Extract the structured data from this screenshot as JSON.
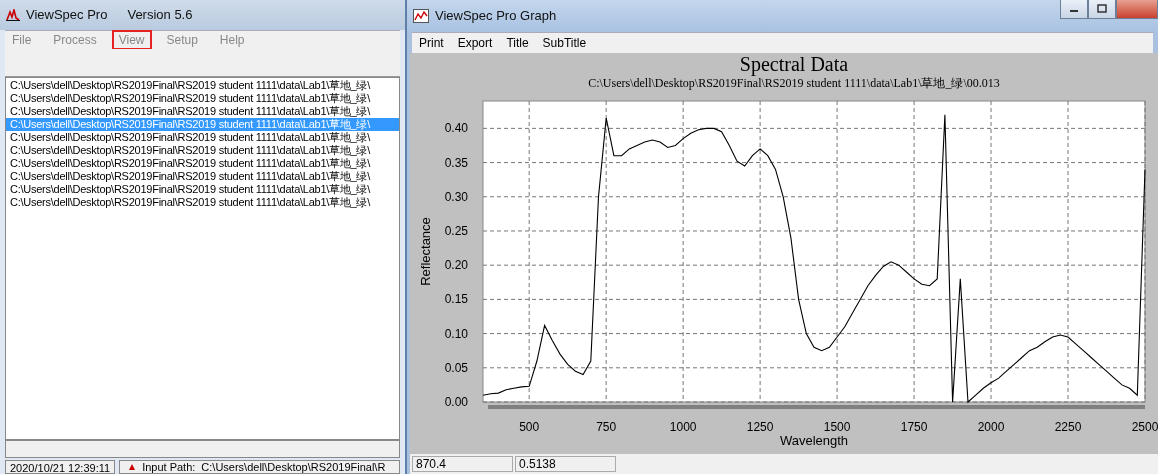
{
  "main_window": {
    "title": "ViewSpec Pro",
    "version": "Version 5.6",
    "menu": [
      {
        "label": "File",
        "highlighted": false
      },
      {
        "label": "Process",
        "highlighted": false
      },
      {
        "label": "View",
        "highlighted": true
      },
      {
        "label": "Setup",
        "highlighted": false
      },
      {
        "label": "Help",
        "highlighted": false
      }
    ],
    "files": [
      {
        "path": "C:\\Users\\dell\\Desktop\\RS2019Final\\RS2019 student 1111\\data\\Lab1\\草地_绿\\",
        "selected": false
      },
      {
        "path": "C:\\Users\\dell\\Desktop\\RS2019Final\\RS2019 student 1111\\data\\Lab1\\草地_绿\\",
        "selected": false
      },
      {
        "path": "C:\\Users\\dell\\Desktop\\RS2019Final\\RS2019 student 1111\\data\\Lab1\\草地_绿\\",
        "selected": false
      },
      {
        "path": "C:\\Users\\dell\\Desktop\\RS2019Final\\RS2019 student 1111\\data\\Lab1\\草地_绿\\",
        "selected": true
      },
      {
        "path": "C:\\Users\\dell\\Desktop\\RS2019Final\\RS2019 student 1111\\data\\Lab1\\草地_绿\\",
        "selected": false
      },
      {
        "path": "C:\\Users\\dell\\Desktop\\RS2019Final\\RS2019 student 1111\\data\\Lab1\\草地_绿\\",
        "selected": false
      },
      {
        "path": "C:\\Users\\dell\\Desktop\\RS2019Final\\RS2019 student 1111\\data\\Lab1\\草地_绿\\",
        "selected": false
      },
      {
        "path": "C:\\Users\\dell\\Desktop\\RS2019Final\\RS2019 student 1111\\data\\Lab1\\草地_绿\\",
        "selected": false
      },
      {
        "path": "C:\\Users\\dell\\Desktop\\RS2019Final\\RS2019 student 1111\\data\\Lab1\\草地_绿\\",
        "selected": false
      },
      {
        "path": "C:\\Users\\dell\\Desktop\\RS2019Final\\RS2019 student 1111\\data\\Lab1\\草地_绿\\",
        "selected": false
      }
    ],
    "status_bar": {
      "time": "2020/10/21 12:39:11",
      "input_label": "Input Path:",
      "input_path": "C:\\Users\\dell\\Desktop\\RS2019Final\\R"
    }
  },
  "graph_window": {
    "title": "ViewSpec Pro Graph",
    "menu": [
      "Print",
      "Export",
      "Title",
      "SubTitle"
    ],
    "chart_data": {
      "type": "line",
      "title": "Spectral Data",
      "subtitle": "C:\\Users\\dell\\Desktop\\RS2019Final\\RS2019 student 1111\\data\\Lab1\\草地_绿\\00.013",
      "xlabel": "Wavelength",
      "ylabel": "Reflectance",
      "x": [
        350,
        375,
        400,
        425,
        450,
        475,
        500,
        525,
        550,
        575,
        600,
        625,
        650,
        675,
        700,
        725,
        750,
        775,
        800,
        825,
        850,
        875,
        900,
        925,
        950,
        975,
        1000,
        1025,
        1050,
        1075,
        1100,
        1125,
        1150,
        1175,
        1200,
        1225,
        1250,
        1275,
        1300,
        1325,
        1350,
        1375,
        1400,
        1425,
        1450,
        1475,
        1500,
        1525,
        1550,
        1575,
        1600,
        1625,
        1650,
        1675,
        1700,
        1725,
        1750,
        1775,
        1800,
        1825,
        1850,
        1875,
        1900,
        1925,
        1950,
        1975,
        2000,
        2025,
        2050,
        2075,
        2100,
        2125,
        2150,
        2175,
        2200,
        2225,
        2250,
        2275,
        2300,
        2325,
        2350,
        2375,
        2400,
        2425,
        2450,
        2475,
        2500
      ],
      "grid": true,
      "series": [
        {
          "color": "#000000",
          "values": [
            0.01,
            0.012,
            0.013,
            0.018,
            0.02,
            0.022,
            0.023,
            0.06,
            0.112,
            0.09,
            0.07,
            0.055,
            0.045,
            0.04,
            0.06,
            0.3,
            0.415,
            0.36,
            0.36,
            0.37,
            0.375,
            0.38,
            0.383,
            0.38,
            0.372,
            0.375,
            0.385,
            0.393,
            0.398,
            0.4,
            0.4,
            0.395,
            0.375,
            0.352,
            0.345,
            0.36,
            0.37,
            0.36,
            0.34,
            0.3,
            0.24,
            0.15,
            0.1,
            0.08,
            0.075,
            0.08,
            0.095,
            0.11,
            0.13,
            0.15,
            0.17,
            0.185,
            0.198,
            0.205,
            0.2,
            0.19,
            0.18,
            0.172,
            0.17,
            0.18,
            0.42,
            0.0,
            0.18,
            0.0,
            0.01,
            0.02,
            0.028,
            0.035,
            0.045,
            0.055,
            0.065,
            0.075,
            0.08,
            0.088,
            0.095,
            0.098,
            0.095,
            0.085,
            0.075,
            0.065,
            0.055,
            0.045,
            0.035,
            0.025,
            0.02,
            0.01,
            0.34
          ]
        }
      ],
      "xlim": [
        350,
        2500
      ],
      "ylim": [
        0,
        0.44
      ],
      "xticks": [
        500,
        750,
        1000,
        1250,
        1500,
        1750,
        2000,
        2250,
        2500
      ],
      "yticks": [
        {
          "value": 0,
          "label": "0.00"
        },
        {
          "value": 0.05,
          "label": "0.05"
        },
        {
          "value": 0.1,
          "label": "0.10"
        },
        {
          "value": 0.15,
          "label": "0.15"
        },
        {
          "value": 0.2,
          "label": "0.20"
        },
        {
          "value": 0.25,
          "label": "0.25"
        },
        {
          "value": 0.3,
          "label": "0.30"
        },
        {
          "value": 0.35,
          "label": "0.35"
        },
        {
          "value": 0.4,
          "label": "0.40"
        }
      ]
    },
    "status_bar": [
      "870.4",
      "0.5138"
    ]
  }
}
